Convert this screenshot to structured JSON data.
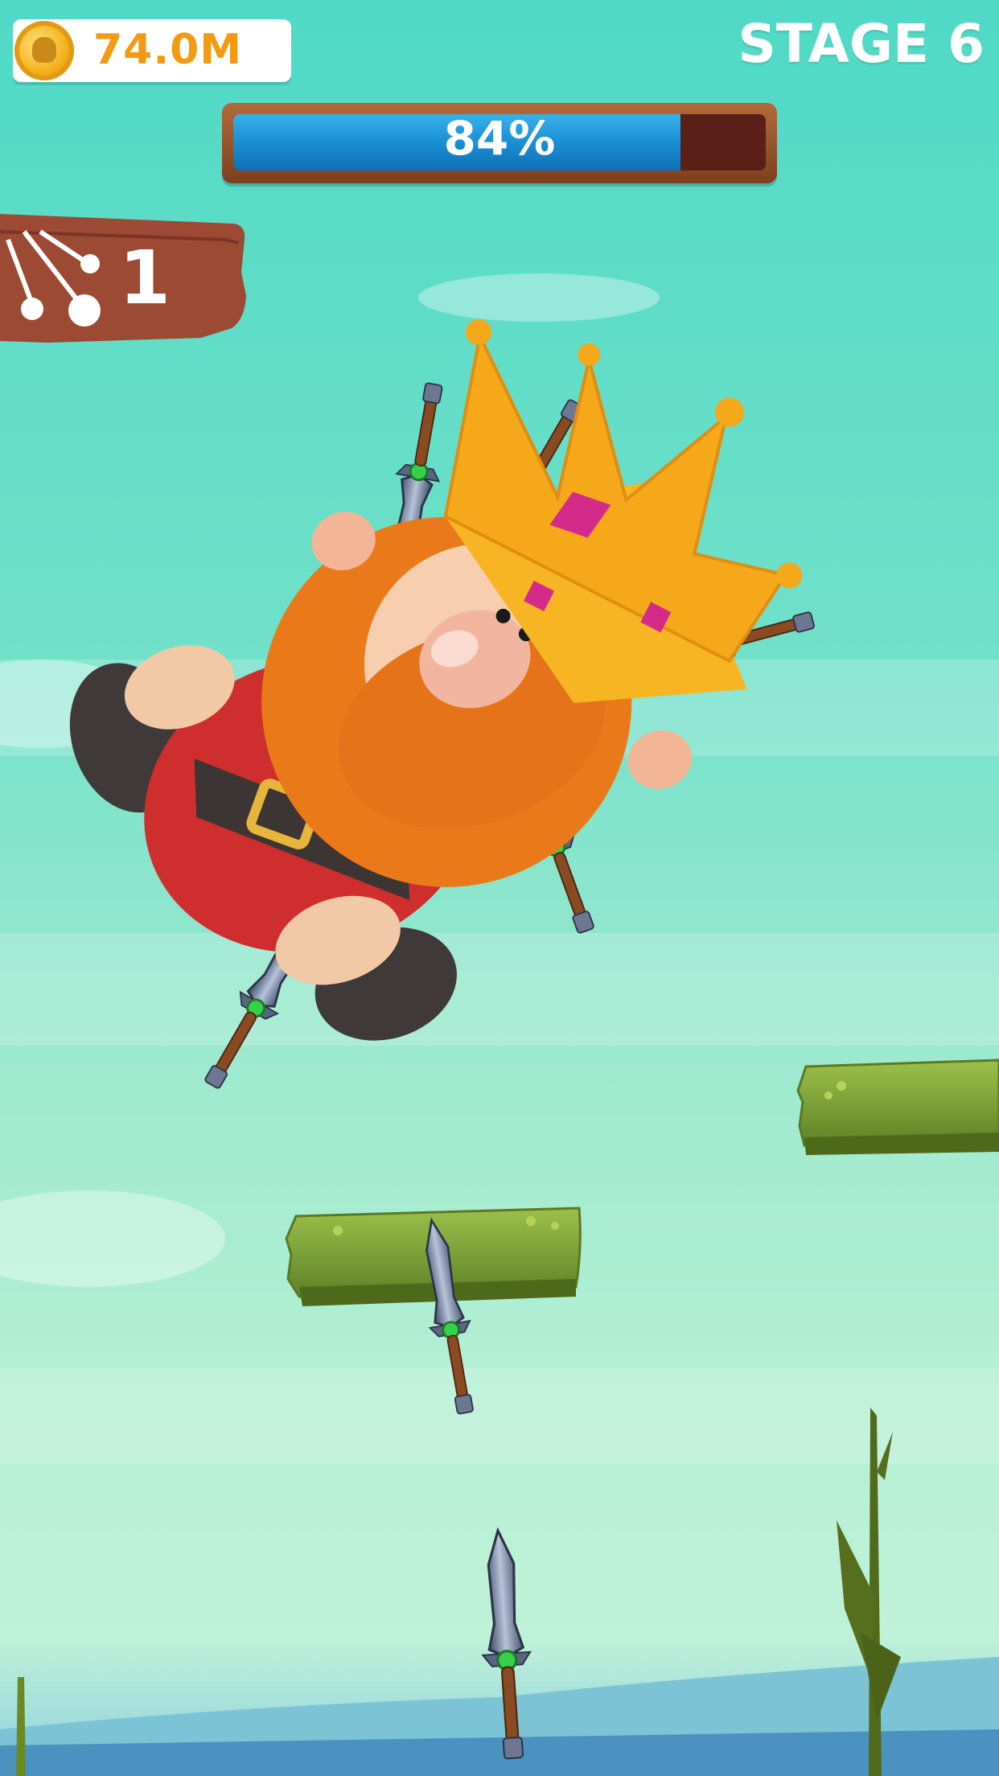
{
  "hud": {
    "coins": "74.0M",
    "stage_label": "STAGE 6",
    "progress_text": "84%",
    "progress_fraction": 0.84,
    "knives_remaining": "1"
  },
  "colors": {
    "background": "#4fd9c6",
    "coin_text": "#f39a12",
    "progress_fill": "#1a8fd3",
    "wood": "#9c4a34",
    "platform": "#7fa33c"
  },
  "icons": {
    "coin": "coin-icon",
    "knives": "throwing-knives-icon"
  }
}
